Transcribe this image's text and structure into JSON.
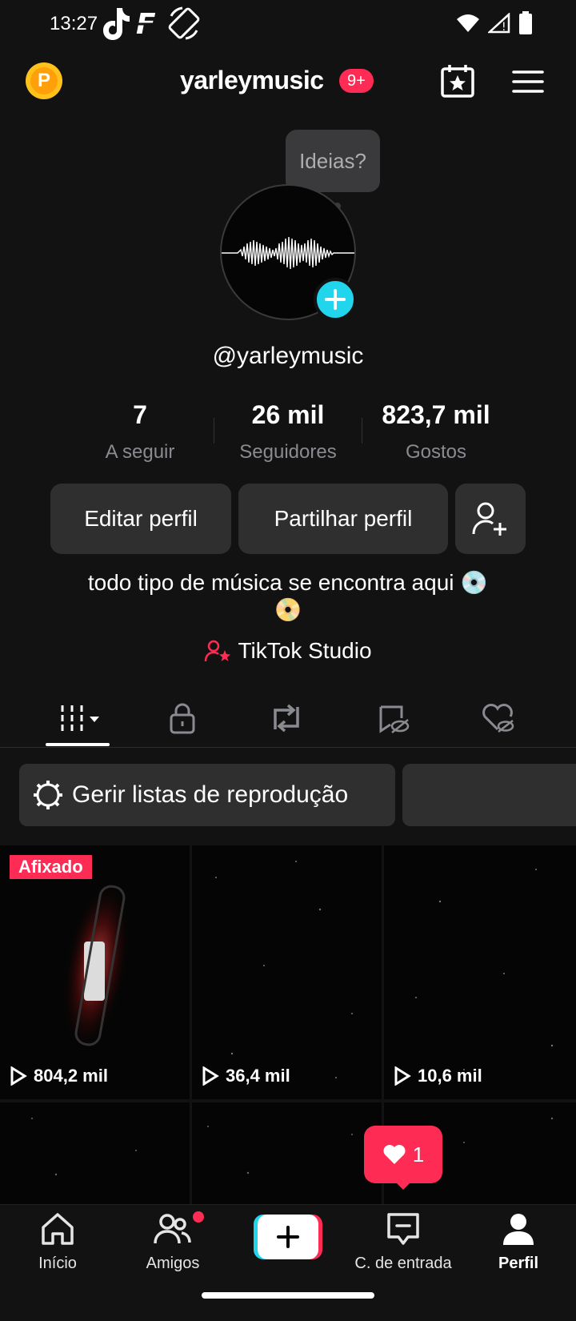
{
  "status_bar": {
    "time": "13:27"
  },
  "header": {
    "username": "yarleymusic",
    "notification_badge": "9+",
    "points_letter": "P"
  },
  "profile": {
    "tooltip": "Ideias?",
    "handle": "@yarleymusic",
    "stats": [
      {
        "value": "7",
        "label": "A seguir"
      },
      {
        "value": "26 mil",
        "label": "Seguidores"
      },
      {
        "value": "823,7 mil",
        "label": "Gostos"
      }
    ],
    "edit_label": "Editar perfil",
    "share_label": "Partilhar perfil",
    "bio_line1": "todo tipo de música se encontra aqui 💿",
    "bio_line2": "📀",
    "studio_label": "TikTok Studio"
  },
  "playlists": {
    "manage_label": "Gerir listas de reprodução"
  },
  "videos": [
    {
      "views": "804,2 mil",
      "pinned": "Afixado"
    },
    {
      "views": "36,4 mil"
    },
    {
      "views": "10,6 mil"
    }
  ],
  "like_notification": {
    "count": "1"
  },
  "bottom_nav": {
    "home": "Início",
    "friends": "Amigos",
    "inbox": "C. de entrada",
    "profile": "Perfil"
  },
  "colors": {
    "accent": "#fe2c55",
    "cyan": "#20d5ec",
    "background": "#121212"
  }
}
